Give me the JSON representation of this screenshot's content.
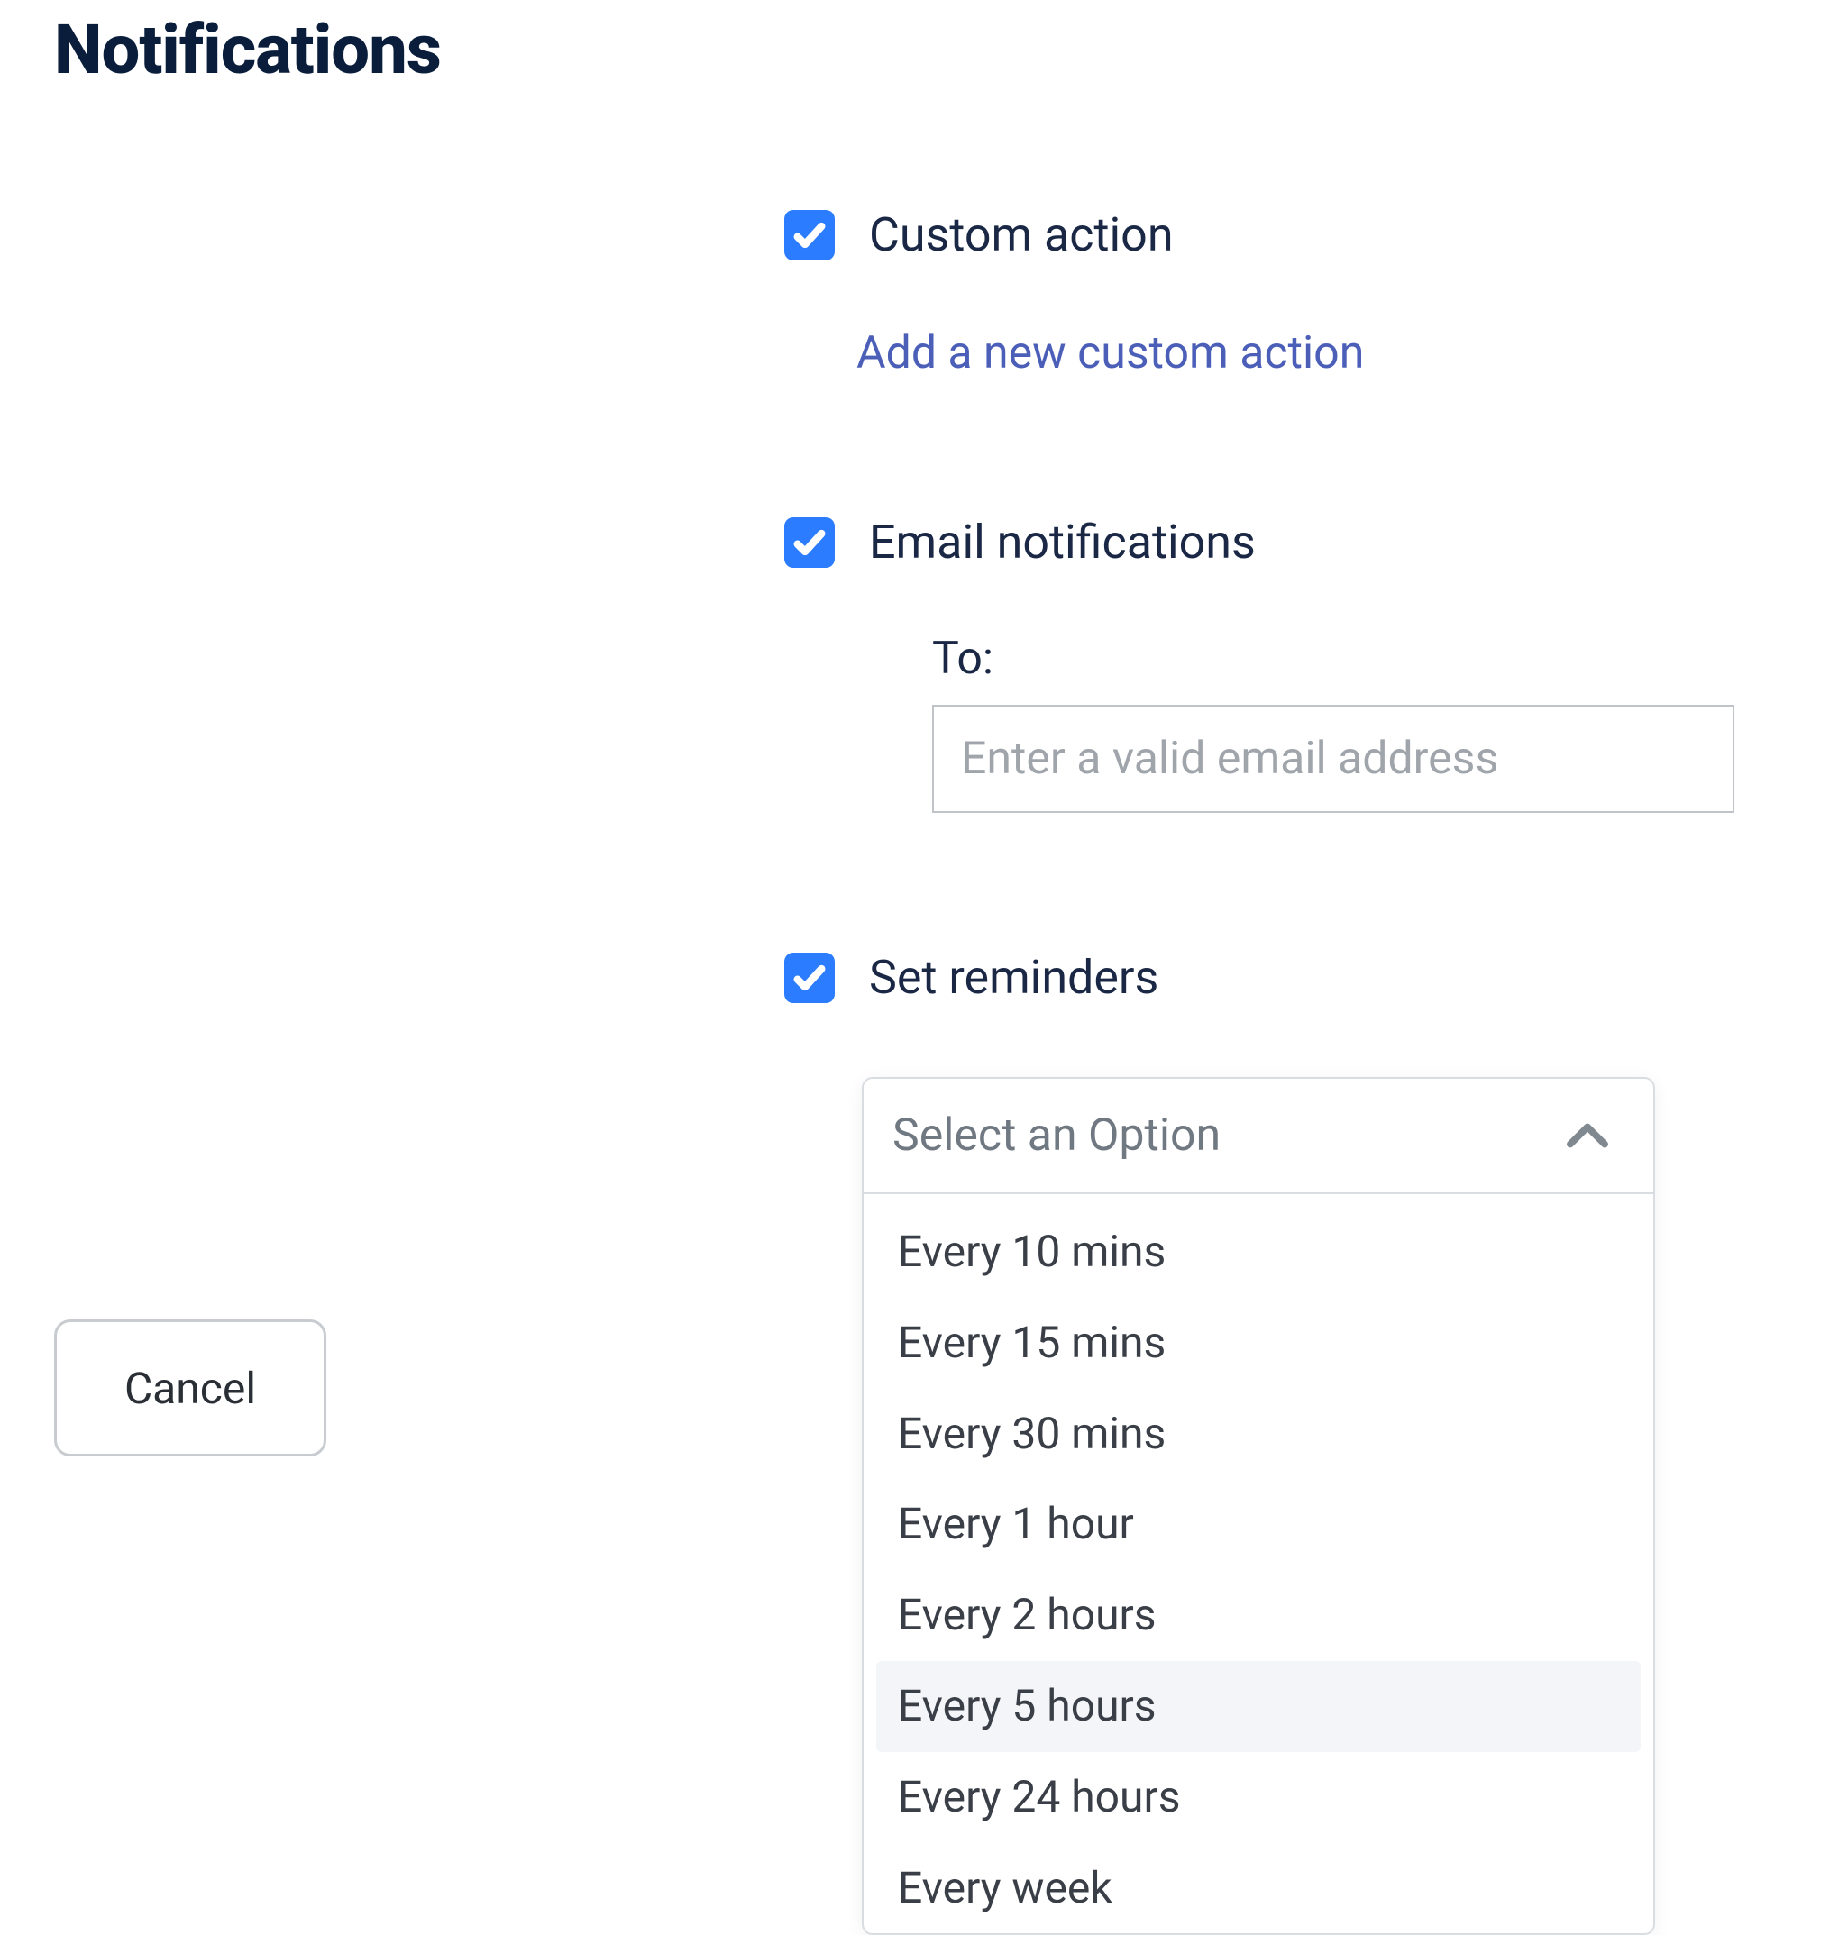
{
  "title": "Notifications",
  "custom_action": {
    "checked": true,
    "label": "Custom action",
    "link_label": "Add a new custom action"
  },
  "email_notifications": {
    "checked": true,
    "label": "Email notifications",
    "to_label": "To:",
    "placeholder": "Enter a valid email address",
    "value": ""
  },
  "reminders": {
    "checked": true,
    "label": "Set reminders",
    "dropdown_placeholder": "Select an Option",
    "options": [
      "Every 10 mins",
      "Every 15 mins",
      "Every 30 mins",
      "Every 1 hour",
      "Every 2 hours",
      "Every 5 hours",
      "Every 24 hours",
      "Every week"
    ],
    "highlighted_index": 5
  },
  "cancel_label": "Cancel"
}
